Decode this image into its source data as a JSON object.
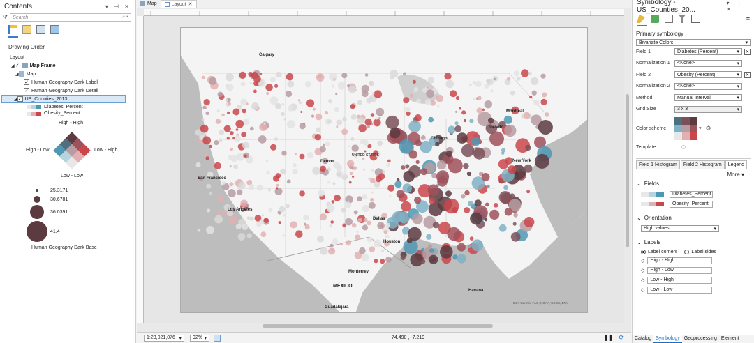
{
  "contents": {
    "title": "Contents",
    "search_placeholder": "Search",
    "drawing_order": "Drawing Order",
    "tree": {
      "layout": "Layout",
      "map_frame": "Map Frame",
      "map": "Map",
      "label_layer": "Human Geography Dark Label",
      "detail_layer": "Human Geography Dark Detail",
      "counties_layer": "US_Counties_2013",
      "field1": "Diabetes_Percent",
      "field2": "Obesity_Percent",
      "high_high": "High - High",
      "high_low": "High - Low",
      "low_high": "Low - High",
      "low_low": "Low - Low",
      "sizes": [
        "25.3171",
        "30.6781",
        "36.0391",
        "41.4"
      ],
      "base_layer": "Human Geography Dark Base"
    }
  },
  "tabs": {
    "map": "Map",
    "layout": "Layout"
  },
  "map_labels": {
    "calgary": "Calgary",
    "montreal": "Montreal",
    "toronto": "Toronto",
    "chicago": "Chicago",
    "new_york": "New York",
    "san_francisco": "San Francisco",
    "los_angeles": "Los Angeles",
    "dallas": "Dallas",
    "houston": "Houston",
    "monterrey": "Monterrey",
    "mexico": "MÉXICO",
    "havana": "Havana",
    "guadalajara": "Guadalajara",
    "attribution": "Esri, Garmin, FAO, NOAA, USGS, EPA",
    "united_states": "UNITED STATES",
    "denver": "Denver"
  },
  "status": {
    "scale": "1:23,021,076",
    "zoom": "92%",
    "coords": "74.498 , -7.219"
  },
  "symbology": {
    "title": "Symbology - US_Counties_20...",
    "primary": "Primary symbology",
    "method_type": "Bivariate Colors",
    "field1_label": "Field 1",
    "field1": "Diabetes (Percent)",
    "norm1_label": "Normalization 1",
    "norm1": "<None>",
    "field2_label": "Field 2",
    "field2": "Obesity (Percent)",
    "norm2_label": "Normalization 2",
    "norm2": "<None>",
    "method_label": "Method",
    "method": "Manual Interval",
    "grid_label": "Grid Size",
    "grid": "3 x 3",
    "scheme_label": "Color scheme",
    "template_label": "Template",
    "tab1": "Field 1 Histogram",
    "tab2": "Field 2 Histogram",
    "tab3": "Legend",
    "more": "More",
    "fields_hdr": "Fields",
    "leg_field1": "Diabetes_Percent",
    "leg_field2": "Obesity_Percent",
    "orient_hdr": "Orientation",
    "orient": "High values",
    "labels_hdr": "Labels",
    "opt_corners": "Label corners",
    "opt_sides": "Label sides",
    "lab1": "High - High",
    "lab2": "High - Low",
    "lab3": "Low - High",
    "lab4": "Low - Low",
    "bottom_tabs": [
      "Catalog",
      "Symbology",
      "Geoprocessing",
      "Element"
    ]
  },
  "colors": {
    "blue": "#4f98b4",
    "red": "#c9474b",
    "dark": "#5b3a40",
    "light": "#e6e6e6",
    "accent": "#3a7bd5"
  }
}
